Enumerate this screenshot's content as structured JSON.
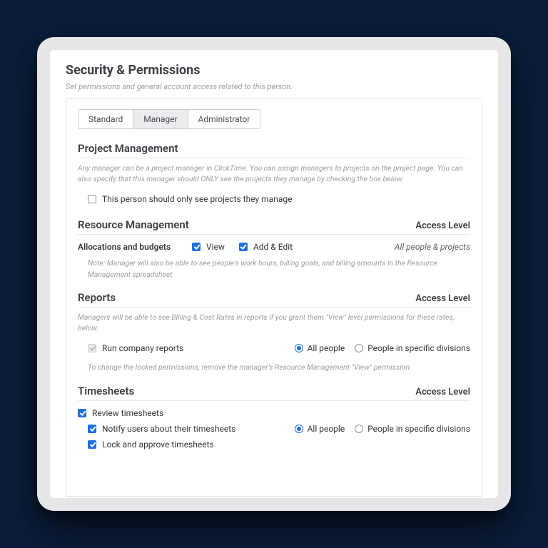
{
  "page": {
    "title": "Security & Permissions",
    "subtitle": "Set permissions and general account access related to this person."
  },
  "tabs": [
    "Standard",
    "Manager",
    "Administrator"
  ],
  "active_tab": 1,
  "project_mgmt": {
    "title": "Project Management",
    "desc": "Any manager can be a project manager in ClickTime. You can assign managers to projects on the project page. You can also specify that this manager should ONLY see the projects they manage by checking the box below.",
    "checkbox_label": "This person should only see projects they manage",
    "checked": false
  },
  "resource_mgmt": {
    "title": "Resource Management",
    "access_label": "Access Level",
    "row_label": "Allocations and budgets",
    "view_label": "View",
    "view_checked": true,
    "edit_label": "Add & Edit",
    "edit_checked": true,
    "scope": "All people & projects",
    "note": "Note: Manager will also be able to see people's work hours, billing goals, and billing amounts in the Resource Management spreadsheet."
  },
  "reports": {
    "title": "Reports",
    "access_label": "Access Level",
    "desc": "Managers will be able to see Billing & Cost Rates in reports if you grant them \"View\" level permissions for these rates, below.",
    "run_label": "Run company reports",
    "run_locked": true,
    "radios": {
      "all": "All people",
      "divisions": "People in specific divisions",
      "selected": "all"
    },
    "locked_note": "To change the locked permissions, remove the manager's Resource Management \"View\" permission."
  },
  "timesheets": {
    "title": "Timesheets",
    "access_label": "Access Level",
    "review": {
      "label": "Review timesheets",
      "checked": true
    },
    "notify": {
      "label": "Notify users about their timesheets",
      "checked": true
    },
    "lock": {
      "label": "Lock and approve timesheets",
      "checked": true
    },
    "radios": {
      "all": "All people",
      "divisions": "People in specific divisions",
      "selected": "all"
    }
  }
}
